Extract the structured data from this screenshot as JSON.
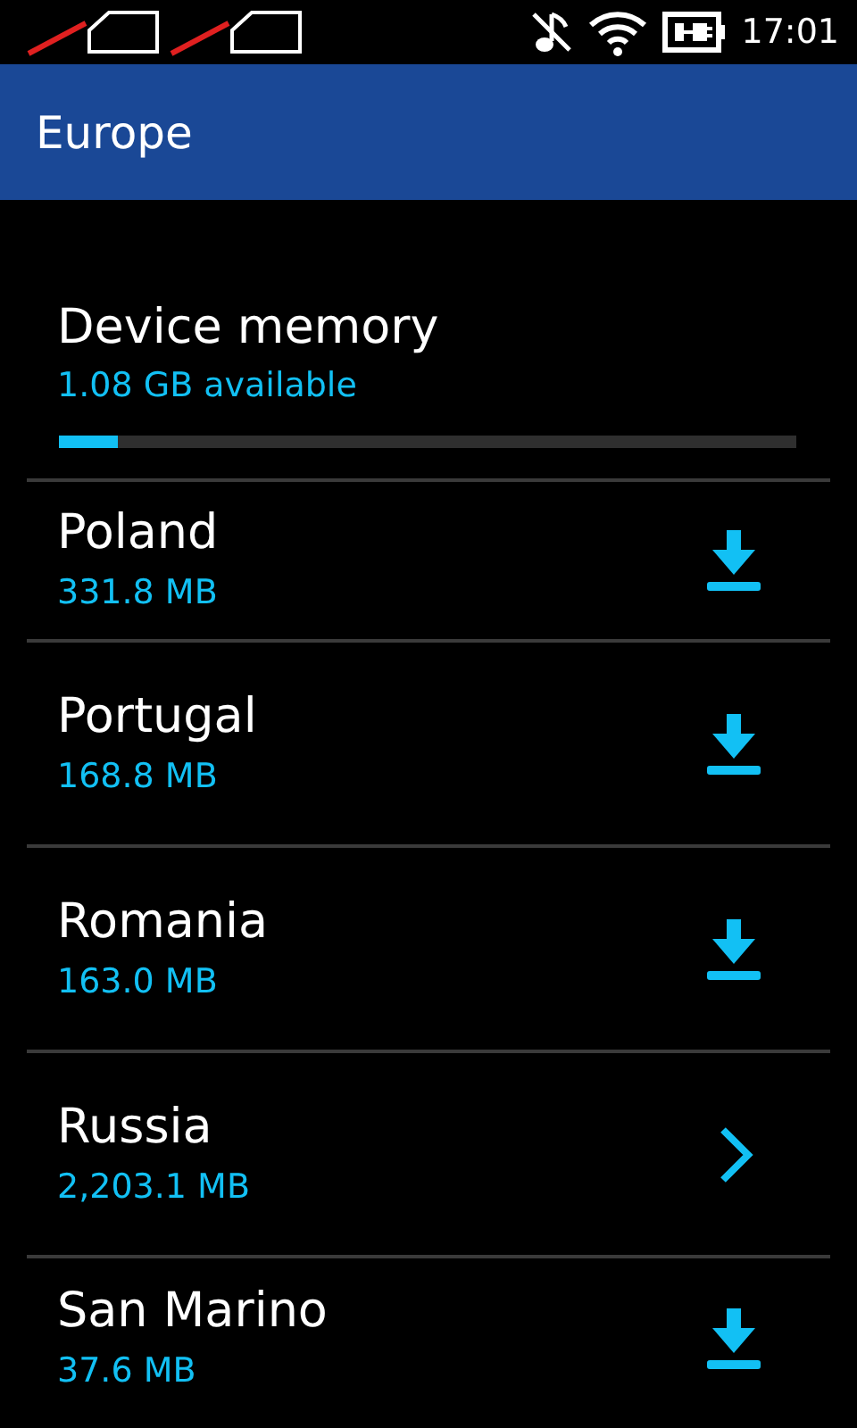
{
  "status_bar": {
    "sims": [
      {
        "present": false
      },
      {
        "present": false
      }
    ],
    "time": "17:01"
  },
  "header": {
    "title": "Europe"
  },
  "memory": {
    "label": "Device memory",
    "available": "1.08 GB available",
    "level": 0.08
  },
  "countries": [
    {
      "name": "Poland",
      "size": "331.8 MB",
      "kind": "download"
    },
    {
      "name": "Portugal",
      "size": "168.8 MB",
      "kind": "download"
    },
    {
      "name": "Romania",
      "size": "163.0 MB",
      "kind": "download"
    },
    {
      "name": "Russia",
      "size": "2,203.1 MB",
      "kind": "open"
    },
    {
      "name": "San Marino",
      "size": "37.6 MB",
      "kind": "download"
    }
  ]
}
